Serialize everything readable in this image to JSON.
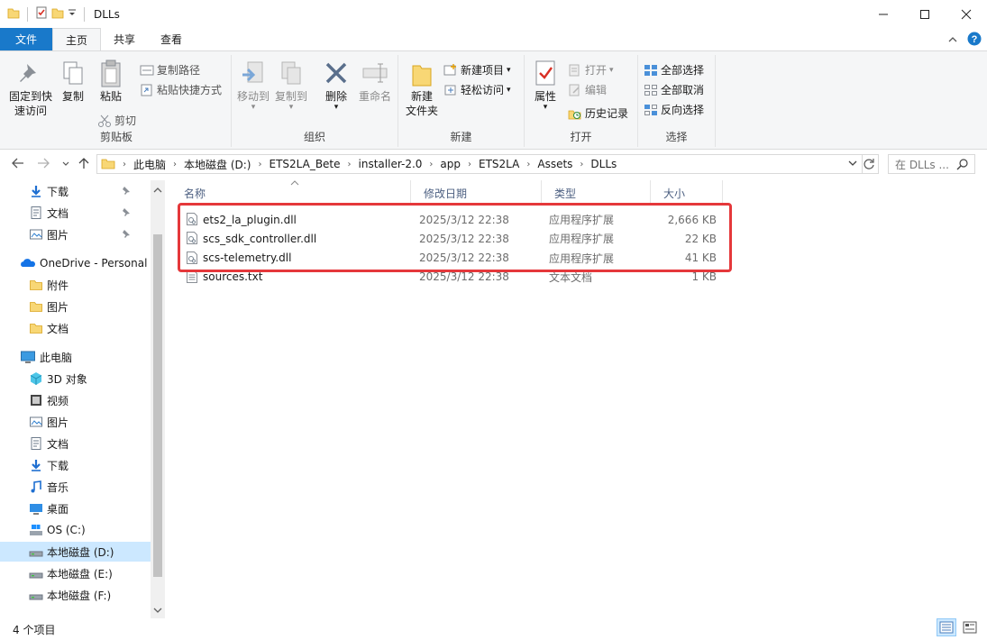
{
  "window": {
    "title": "DLLs",
    "colors": {
      "accent": "#1979ca",
      "highlight": "#e5383b",
      "selected": "#cce8ff"
    }
  },
  "tabs": {
    "file": "文件",
    "home": "主页",
    "share": "共享",
    "view": "查看"
  },
  "ribbon": {
    "clipboard": {
      "label": "剪贴板",
      "pin_quick_access": "固定到快\n速访问",
      "pin_line1": "固定到快",
      "pin_line2": "速访问",
      "copy": "复制",
      "paste": "粘贴",
      "copy_path": "复制路径",
      "paste_shortcut": "粘贴快捷方式",
      "cut": "剪切"
    },
    "organize": {
      "label": "组织",
      "move_to": "移动到",
      "copy_to": "复制到",
      "delete": "删除",
      "rename": "重命名"
    },
    "new": {
      "label": "新建",
      "new_folder_line1": "新建",
      "new_folder_line2": "文件夹",
      "new_item": "新建项目",
      "easy_access": "轻松访问"
    },
    "open": {
      "label": "打开",
      "properties": "属性",
      "open": "打开",
      "edit": "编辑",
      "history": "历史记录"
    },
    "select": {
      "label": "选择",
      "select_all": "全部选择",
      "select_none": "全部取消",
      "invert": "反向选择"
    }
  },
  "address": {
    "crumbs": [
      "此电脑",
      "本地磁盘 (D:)",
      "ETS2LA_Bete",
      "installer-2.0",
      "app",
      "ETS2LA",
      "Assets",
      "DLLs"
    ],
    "search_placeholder": "在 DLLs ..."
  },
  "nav": {
    "quick": [
      {
        "label": "下载",
        "icon": "download-icon"
      },
      {
        "label": "文档",
        "icon": "document-icon"
      },
      {
        "label": "图片",
        "icon": "pictures-icon"
      }
    ],
    "onedrive": {
      "label": "OneDrive - Personal",
      "items": [
        "附件",
        "图片",
        "文档"
      ]
    },
    "pc": {
      "label": "此电脑",
      "items": [
        {
          "label": "3D 对象",
          "icon": "3d-objects-icon"
        },
        {
          "label": "视频",
          "icon": "video-icon"
        },
        {
          "label": "图片",
          "icon": "pictures-icon"
        },
        {
          "label": "文档",
          "icon": "document-icon"
        },
        {
          "label": "下载",
          "icon": "download-icon"
        },
        {
          "label": "音乐",
          "icon": "music-icon"
        },
        {
          "label": "桌面",
          "icon": "desktop-icon"
        },
        {
          "label": "OS (C:)",
          "icon": "os-drive-icon"
        },
        {
          "label": "本地磁盘 (D:)",
          "icon": "drive-icon"
        },
        {
          "label": "本地磁盘 (E:)",
          "icon": "drive-icon"
        },
        {
          "label": "本地磁盘 (F:)",
          "icon": "drive-icon"
        }
      ]
    }
  },
  "columns": {
    "name": "名称",
    "modified": "修改日期",
    "type": "类型",
    "size": "大小"
  },
  "files": [
    {
      "name": "ets2_la_plugin.dll",
      "modified": "2025/3/12 22:38",
      "type": "应用程序扩展",
      "size": "2,666 KB"
    },
    {
      "name": "scs_sdk_controller.dll",
      "modified": "2025/3/12 22:38",
      "type": "应用程序扩展",
      "size": "22 KB"
    },
    {
      "name": "scs-telemetry.dll",
      "modified": "2025/3/12 22:38",
      "type": "应用程序扩展",
      "size": "41 KB"
    },
    {
      "name": "sources.txt",
      "modified": "2025/3/12 22:38",
      "type": "文本文档",
      "size": "1 KB"
    }
  ],
  "status": {
    "count": "4 个项目"
  }
}
